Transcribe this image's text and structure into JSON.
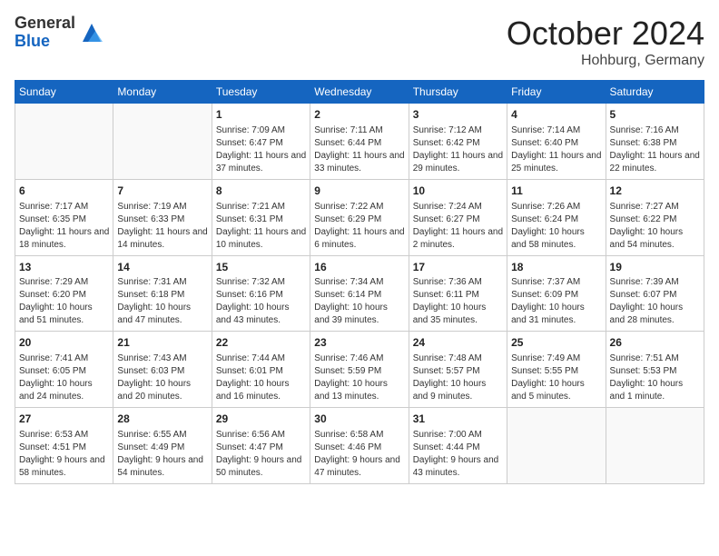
{
  "header": {
    "logo_general": "General",
    "logo_blue": "Blue",
    "month": "October 2024",
    "location": "Hohburg, Germany"
  },
  "columns": [
    "Sunday",
    "Monday",
    "Tuesday",
    "Wednesday",
    "Thursday",
    "Friday",
    "Saturday"
  ],
  "weeks": [
    [
      {
        "day": "",
        "info": ""
      },
      {
        "day": "",
        "info": ""
      },
      {
        "day": "1",
        "info": "Sunrise: 7:09 AM\nSunset: 6:47 PM\nDaylight: 11 hours and 37 minutes."
      },
      {
        "day": "2",
        "info": "Sunrise: 7:11 AM\nSunset: 6:44 PM\nDaylight: 11 hours and 33 minutes."
      },
      {
        "day": "3",
        "info": "Sunrise: 7:12 AM\nSunset: 6:42 PM\nDaylight: 11 hours and 29 minutes."
      },
      {
        "day": "4",
        "info": "Sunrise: 7:14 AM\nSunset: 6:40 PM\nDaylight: 11 hours and 25 minutes."
      },
      {
        "day": "5",
        "info": "Sunrise: 7:16 AM\nSunset: 6:38 PM\nDaylight: 11 hours and 22 minutes."
      }
    ],
    [
      {
        "day": "6",
        "info": "Sunrise: 7:17 AM\nSunset: 6:35 PM\nDaylight: 11 hours and 18 minutes."
      },
      {
        "day": "7",
        "info": "Sunrise: 7:19 AM\nSunset: 6:33 PM\nDaylight: 11 hours and 14 minutes."
      },
      {
        "day": "8",
        "info": "Sunrise: 7:21 AM\nSunset: 6:31 PM\nDaylight: 11 hours and 10 minutes."
      },
      {
        "day": "9",
        "info": "Sunrise: 7:22 AM\nSunset: 6:29 PM\nDaylight: 11 hours and 6 minutes."
      },
      {
        "day": "10",
        "info": "Sunrise: 7:24 AM\nSunset: 6:27 PM\nDaylight: 11 hours and 2 minutes."
      },
      {
        "day": "11",
        "info": "Sunrise: 7:26 AM\nSunset: 6:24 PM\nDaylight: 10 hours and 58 minutes."
      },
      {
        "day": "12",
        "info": "Sunrise: 7:27 AM\nSunset: 6:22 PM\nDaylight: 10 hours and 54 minutes."
      }
    ],
    [
      {
        "day": "13",
        "info": "Sunrise: 7:29 AM\nSunset: 6:20 PM\nDaylight: 10 hours and 51 minutes."
      },
      {
        "day": "14",
        "info": "Sunrise: 7:31 AM\nSunset: 6:18 PM\nDaylight: 10 hours and 47 minutes."
      },
      {
        "day": "15",
        "info": "Sunrise: 7:32 AM\nSunset: 6:16 PM\nDaylight: 10 hours and 43 minutes."
      },
      {
        "day": "16",
        "info": "Sunrise: 7:34 AM\nSunset: 6:14 PM\nDaylight: 10 hours and 39 minutes."
      },
      {
        "day": "17",
        "info": "Sunrise: 7:36 AM\nSunset: 6:11 PM\nDaylight: 10 hours and 35 minutes."
      },
      {
        "day": "18",
        "info": "Sunrise: 7:37 AM\nSunset: 6:09 PM\nDaylight: 10 hours and 31 minutes."
      },
      {
        "day": "19",
        "info": "Sunrise: 7:39 AM\nSunset: 6:07 PM\nDaylight: 10 hours and 28 minutes."
      }
    ],
    [
      {
        "day": "20",
        "info": "Sunrise: 7:41 AM\nSunset: 6:05 PM\nDaylight: 10 hours and 24 minutes."
      },
      {
        "day": "21",
        "info": "Sunrise: 7:43 AM\nSunset: 6:03 PM\nDaylight: 10 hours and 20 minutes."
      },
      {
        "day": "22",
        "info": "Sunrise: 7:44 AM\nSunset: 6:01 PM\nDaylight: 10 hours and 16 minutes."
      },
      {
        "day": "23",
        "info": "Sunrise: 7:46 AM\nSunset: 5:59 PM\nDaylight: 10 hours and 13 minutes."
      },
      {
        "day": "24",
        "info": "Sunrise: 7:48 AM\nSunset: 5:57 PM\nDaylight: 10 hours and 9 minutes."
      },
      {
        "day": "25",
        "info": "Sunrise: 7:49 AM\nSunset: 5:55 PM\nDaylight: 10 hours and 5 minutes."
      },
      {
        "day": "26",
        "info": "Sunrise: 7:51 AM\nSunset: 5:53 PM\nDaylight: 10 hours and 1 minute."
      }
    ],
    [
      {
        "day": "27",
        "info": "Sunrise: 6:53 AM\nSunset: 4:51 PM\nDaylight: 9 hours and 58 minutes."
      },
      {
        "day": "28",
        "info": "Sunrise: 6:55 AM\nSunset: 4:49 PM\nDaylight: 9 hours and 54 minutes."
      },
      {
        "day": "29",
        "info": "Sunrise: 6:56 AM\nSunset: 4:47 PM\nDaylight: 9 hours and 50 minutes."
      },
      {
        "day": "30",
        "info": "Sunrise: 6:58 AM\nSunset: 4:46 PM\nDaylight: 9 hours and 47 minutes."
      },
      {
        "day": "31",
        "info": "Sunrise: 7:00 AM\nSunset: 4:44 PM\nDaylight: 9 hours and 43 minutes."
      },
      {
        "day": "",
        "info": ""
      },
      {
        "day": "",
        "info": ""
      }
    ]
  ]
}
